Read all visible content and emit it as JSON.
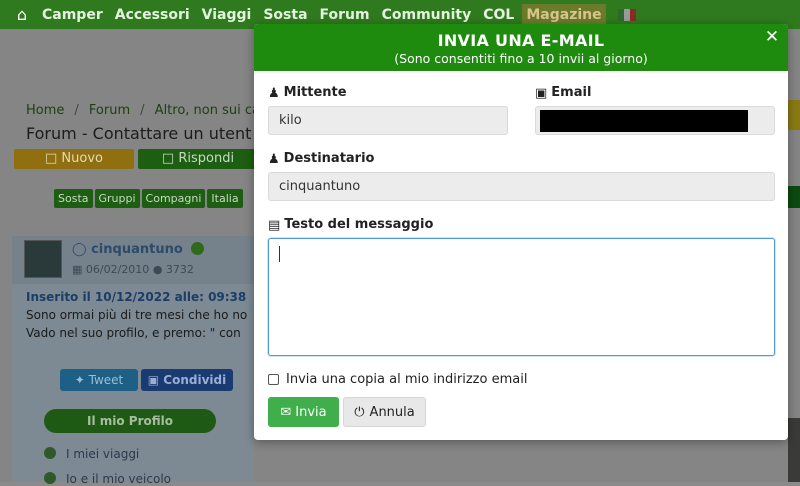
{
  "topnav": {
    "items": [
      "Camper",
      "Accessori",
      "Viaggi",
      "Sosta",
      "Forum",
      "Community",
      "COL"
    ],
    "magazine": "Magazine",
    "icons": {
      "home": "home-icon",
      "flag": "italy-flag-icon"
    }
  },
  "background": {
    "breadcrumb": [
      "Home",
      "Forum",
      "Altro, non sui cam"
    ],
    "page_title": "Forum - Contattare un utent",
    "nuovo_label": "Nuovo",
    "rispondi_label": "Rispondi",
    "tabs": [
      "Sosta",
      "Gruppi",
      "Compagni",
      "Italia"
    ],
    "post": {
      "username": "cinquantuno",
      "registered": "06/02/2010",
      "post_count": "3732",
      "inserted": "Inserito il 10/12/2022 alle: 09:38",
      "line1": "Sono ormai più di tre mesi che ho no",
      "line2": "Vado nel suo profilo, e premo: \" con"
    },
    "share_twitter": "Tweet",
    "share_facebook": "Condividi",
    "profile_button": "Il mio Profilo",
    "side_links": [
      "I miei viaggi",
      "Io e il mio veicolo"
    ]
  },
  "modal": {
    "title": "INVIA UNA E-MAIL",
    "subtitle": "(Sono consentiti fino a 10 invii al giorno)",
    "sender_label": "Mittente",
    "sender_value": "kilo",
    "email_label": "Email",
    "recipient_label": "Destinatario",
    "recipient_value": "cinquantuno",
    "message_label": "Testo del messaggio",
    "message_value": "",
    "copy_label": "Invia una copia al mio indirizzo email",
    "copy_checked": false,
    "send_label": "Invia",
    "cancel_label": "Annula",
    "colors": {
      "header": "#1e8a0e",
      "send": "#3fae4b",
      "focus_border": "#4f9ad3"
    }
  }
}
